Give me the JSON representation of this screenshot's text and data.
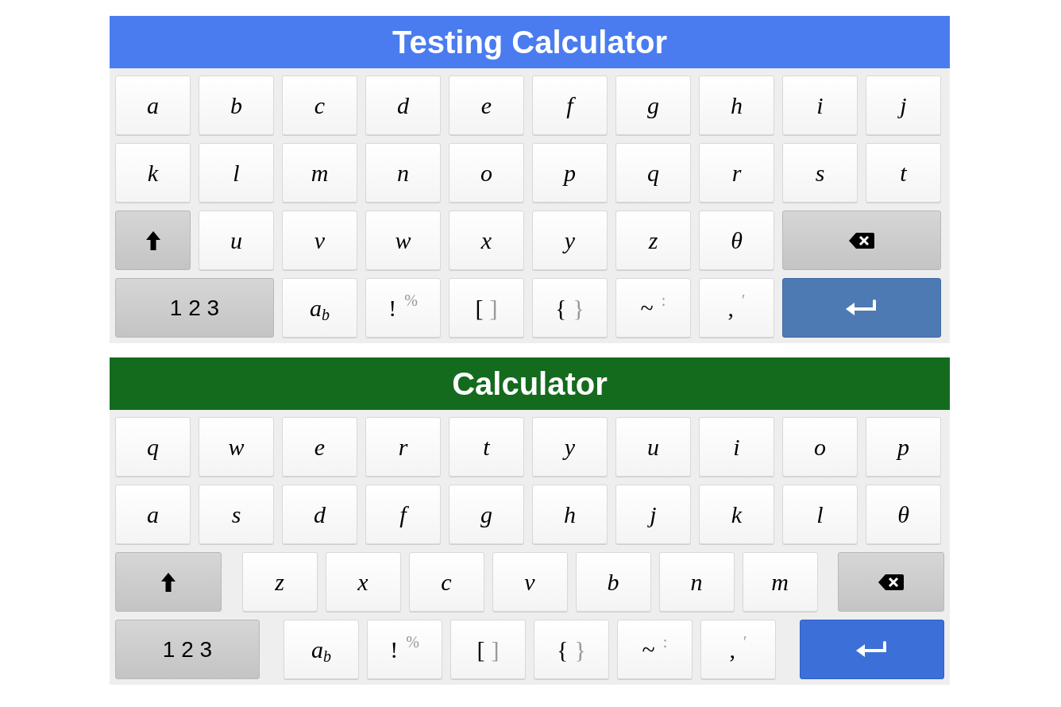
{
  "keyboards": [
    {
      "title": "Testing Calculator",
      "color": "#4a7cf0",
      "kind": "alphabetical",
      "key_rows": [
        {
          "keys": [
            {
              "kind": "letter",
              "label": "a"
            },
            {
              "kind": "letter",
              "label": "b"
            },
            {
              "kind": "letter",
              "label": "c"
            },
            {
              "kind": "letter",
              "label": "d"
            },
            {
              "kind": "letter",
              "label": "e"
            },
            {
              "kind": "letter",
              "label": "f"
            },
            {
              "kind": "letter",
              "label": "g"
            },
            {
              "kind": "letter",
              "label": "h"
            },
            {
              "kind": "letter",
              "label": "i"
            },
            {
              "kind": "letter",
              "label": "j"
            }
          ]
        },
        {
          "keys": [
            {
              "kind": "letter",
              "label": "k"
            },
            {
              "kind": "letter",
              "label": "l"
            },
            {
              "kind": "letter",
              "label": "m"
            },
            {
              "kind": "letter",
              "label": "n"
            },
            {
              "kind": "letter",
              "label": "o"
            },
            {
              "kind": "letter",
              "label": "p"
            },
            {
              "kind": "letter",
              "label": "q"
            },
            {
              "kind": "letter",
              "label": "r"
            },
            {
              "kind": "letter",
              "label": "s"
            },
            {
              "kind": "letter",
              "label": "t"
            }
          ]
        },
        {
          "keys": [
            {
              "kind": "shift"
            },
            {
              "kind": "letter",
              "label": "u"
            },
            {
              "kind": "letter",
              "label": "v"
            },
            {
              "kind": "letter",
              "label": "w"
            },
            {
              "kind": "letter",
              "label": "x"
            },
            {
              "kind": "letter",
              "label": "y"
            },
            {
              "kind": "letter",
              "label": "z"
            },
            {
              "kind": "letter",
              "label": "θ"
            },
            {
              "kind": "backspace"
            }
          ]
        },
        {
          "keys": [
            {
              "kind": "numbers",
              "label": "1 2 3"
            },
            {
              "kind": "subscript",
              "label": "a",
              "extra": "b"
            },
            {
              "kind": "raised",
              "label": "!",
              "extra": "%"
            },
            {
              "kind": "pair",
              "label": "[",
              "extra": "]"
            },
            {
              "kind": "pair",
              "label": "{",
              "extra": "}"
            },
            {
              "kind": "raised",
              "label": "~",
              "extra": ":"
            },
            {
              "kind": "raised",
              "label": ",",
              "extra": "′"
            },
            {
              "kind": "enter"
            }
          ]
        }
      ]
    },
    {
      "title": "Calculator",
      "color": "#146b1e",
      "kind": "qwerty",
      "key_rows": [
        {
          "keys": [
            {
              "kind": "letter",
              "label": "q"
            },
            {
              "kind": "letter",
              "label": "w"
            },
            {
              "kind": "letter",
              "label": "e"
            },
            {
              "kind": "letter",
              "label": "r"
            },
            {
              "kind": "letter",
              "label": "t"
            },
            {
              "kind": "letter",
              "label": "y"
            },
            {
              "kind": "letter",
              "label": "u"
            },
            {
              "kind": "letter",
              "label": "i"
            },
            {
              "kind": "letter",
              "label": "o"
            },
            {
              "kind": "letter",
              "label": "p"
            }
          ]
        },
        {
          "keys": [
            {
              "kind": "letter",
              "label": "a"
            },
            {
              "kind": "letter",
              "label": "s"
            },
            {
              "kind": "letter",
              "label": "d"
            },
            {
              "kind": "letter",
              "label": "f"
            },
            {
              "kind": "letter",
              "label": "g"
            },
            {
              "kind": "letter",
              "label": "h"
            },
            {
              "kind": "letter",
              "label": "j"
            },
            {
              "kind": "letter",
              "label": "k"
            },
            {
              "kind": "letter",
              "label": "l"
            },
            {
              "kind": "letter",
              "label": "θ"
            }
          ]
        },
        {
          "keys": [
            {
              "kind": "shift"
            },
            {
              "kind": "letter",
              "label": "z"
            },
            {
              "kind": "letter",
              "label": "x"
            },
            {
              "kind": "letter",
              "label": "c"
            },
            {
              "kind": "letter",
              "label": "v"
            },
            {
              "kind": "letter",
              "label": "b"
            },
            {
              "kind": "letter",
              "label": "n"
            },
            {
              "kind": "letter",
              "label": "m"
            },
            {
              "kind": "backspace"
            }
          ]
        },
        {
          "keys": [
            {
              "kind": "numbers",
              "label": "1 2 3"
            },
            {
              "kind": "subscript",
              "label": "a",
              "extra": "b"
            },
            {
              "kind": "raised",
              "label": "!",
              "extra": "%"
            },
            {
              "kind": "pair",
              "label": "[",
              "extra": "]"
            },
            {
              "kind": "pair",
              "label": "{",
              "extra": "}"
            },
            {
              "kind": "raised",
              "label": "~",
              "extra": ":"
            },
            {
              "kind": "raised",
              "label": ",",
              "extra": "′"
            },
            {
              "kind": "enter"
            }
          ]
        }
      ]
    }
  ]
}
